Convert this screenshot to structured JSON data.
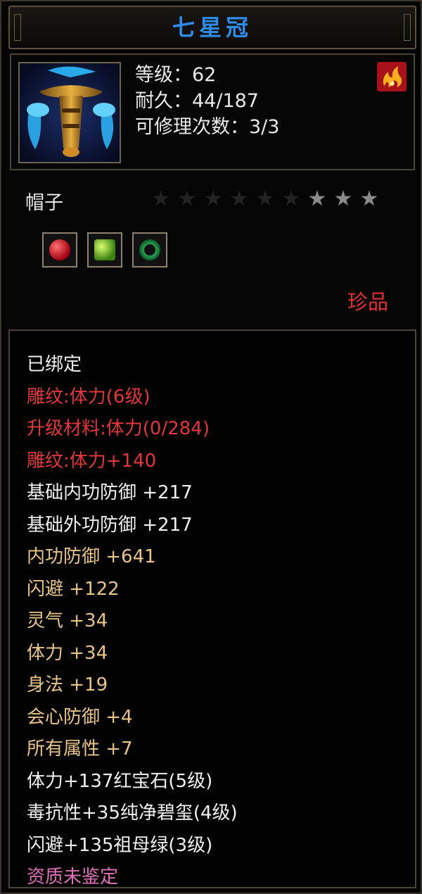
{
  "item": {
    "title": "七星冠",
    "stats": [
      "等级：62",
      "耐久：44/187",
      "可修理次数：3/3"
    ],
    "type": "帽子",
    "stars": {
      "total": 9,
      "lit": 3
    },
    "gem_icons": [
      "ruby-gem-icon",
      "peridot-gem-icon",
      "jade-ring-icon"
    ],
    "rarity": "珍品"
  },
  "properties": [
    {
      "text": "已绑定",
      "color": "white"
    },
    {
      "text": "雕纹:体力(6级)",
      "color": "red"
    },
    {
      "text": "升级材料:体力(0/284)",
      "color": "red"
    },
    {
      "text": "雕纹:体力+140",
      "color": "red"
    },
    {
      "text": "基础内功防御 +217",
      "color": "white"
    },
    {
      "text": "基础外功防御 +217",
      "color": "white"
    },
    {
      "text": "内功防御 +641",
      "color": "gold"
    },
    {
      "text": "闪避 +122",
      "color": "gold"
    },
    {
      "text": "灵气 +34",
      "color": "gold"
    },
    {
      "text": "体力 +34",
      "color": "gold"
    },
    {
      "text": "身法 +19",
      "color": "gold"
    },
    {
      "text": "会心防御 +4",
      "color": "gold"
    },
    {
      "text": "所有属性 +7",
      "color": "gold"
    },
    {
      "text": "体力+137红宝石(5级)",
      "color": "white"
    },
    {
      "text": "毒抗性+35纯净碧玺(4级)",
      "color": "white"
    },
    {
      "text": "闪避+135祖母绿(3级)",
      "color": "white"
    },
    {
      "text": "资质未鉴定",
      "color": "pink"
    }
  ],
  "colors": {
    "title": "#2f8be8",
    "red": "#e0383a",
    "gold": "#e8c488",
    "white": "#f0f0f0",
    "pink": "#e070b8"
  }
}
